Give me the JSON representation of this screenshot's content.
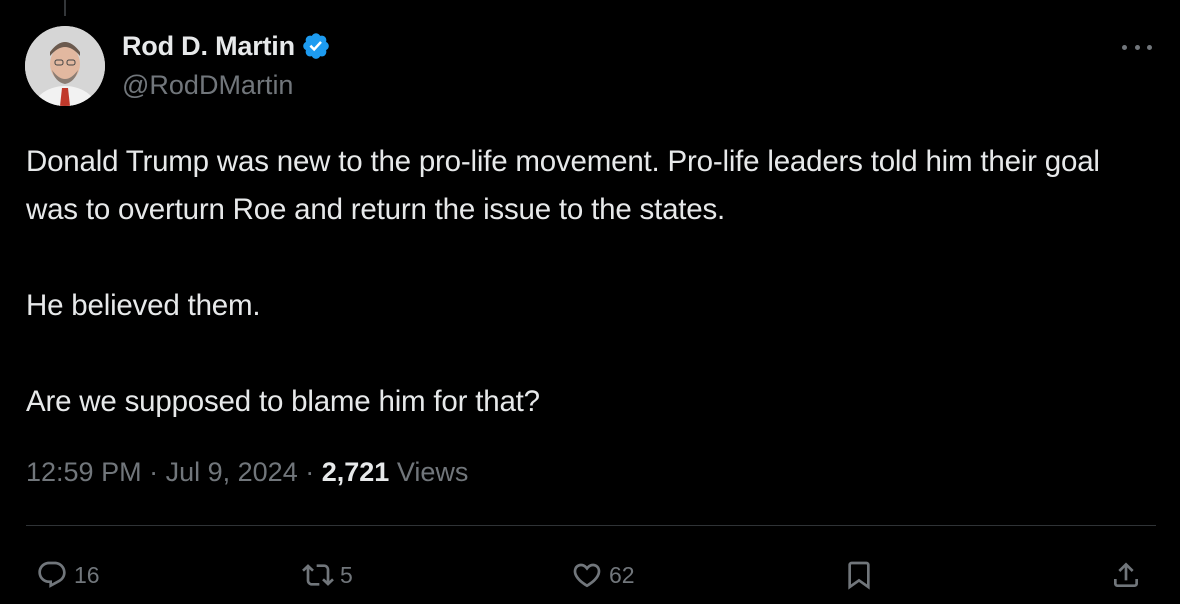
{
  "author": {
    "display_name": "Rod D. Martin",
    "handle": "@RodDMartin",
    "verified": true
  },
  "tweet": {
    "paragraphs": [
      "Donald Trump was new to the pro-life movement. Pro-life leaders told him their goal was to overturn Roe and return the issue to the states.",
      "He believed them.",
      "Are we supposed to blame him for that?"
    ],
    "time": "12:59 PM",
    "date": "Jul 9, 2024",
    "separator": "·",
    "views_count": "2,721",
    "views_label": "Views"
  },
  "actions": {
    "reply_count": "16",
    "retweet_count": "5",
    "like_count": "62"
  },
  "icons": {
    "verified": "verified-badge-icon",
    "more": "more-icon",
    "reply": "reply-icon",
    "retweet": "retweet-icon",
    "like": "heart-icon",
    "bookmark": "bookmark-icon",
    "share": "share-icon"
  },
  "colors": {
    "background": "#000000",
    "text_primary": "#e7e9ea",
    "text_secondary": "#71767b",
    "verified_blue": "#1d9bf0",
    "divider": "#2f3336"
  }
}
